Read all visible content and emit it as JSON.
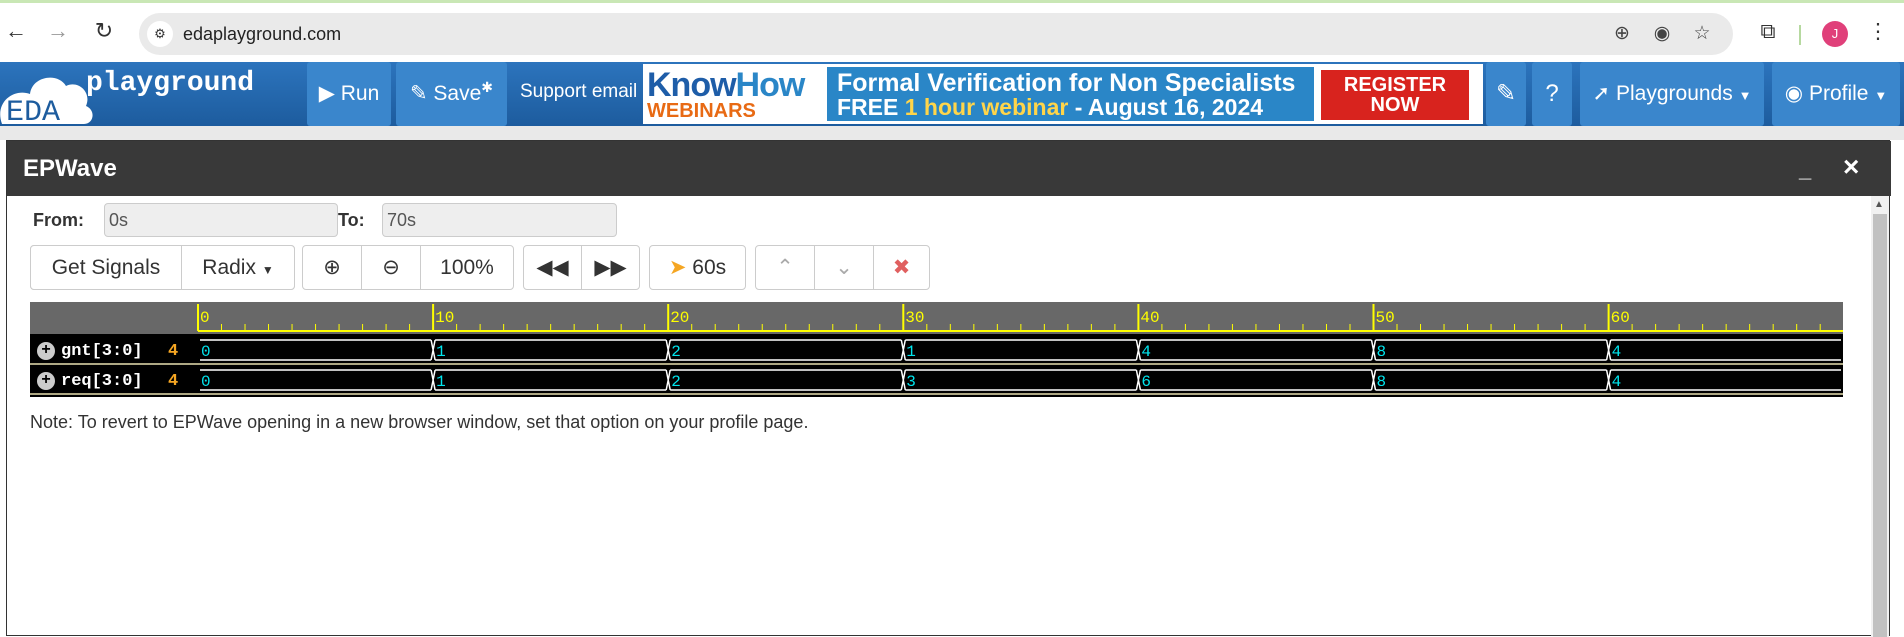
{
  "browser": {
    "url": "edaplayground.com",
    "avatar_initial": "J"
  },
  "header": {
    "logo_eda": "EDA",
    "logo_playground": "playground",
    "run_label": "Run",
    "save_label": "Save",
    "save_mark": "✱",
    "support_label": "Support email",
    "banner": {
      "knowhow_a": "Know",
      "knowhow_b": "How",
      "webinars": "WEBINARS",
      "line1": "Formal Verification for Non Specialists",
      "line2_a": "FREE ",
      "line2_b": "1 hour webinar",
      "line2_c": "  -  August 16, 2024",
      "register_1": "REGISTER",
      "register_2": "NOW"
    },
    "playgrounds_label": "Playgrounds",
    "profile_label": "Profile"
  },
  "modal": {
    "title": "EPWave",
    "from_label": "From:",
    "from_value": "0s",
    "to_label": "To:",
    "to_value": "70s",
    "toolbar": {
      "get_signals": "Get Signals",
      "radix": "Radix",
      "zoom_level": "100%",
      "cursor_time": "60s"
    },
    "note": "Note: To revert to EPWave opening in a new browser window, set that option on your profile page."
  },
  "waveform": {
    "time_start": 0,
    "time_end": 70,
    "ruler_labels": [
      "0",
      "10",
      "20",
      "30",
      "40",
      "50",
      "60"
    ],
    "signals": [
      {
        "name": "gnt[3:0]",
        "current": "4",
        "segments": [
          {
            "t": 0,
            "v": "0"
          },
          {
            "t": 10,
            "v": "1"
          },
          {
            "t": 20,
            "v": "2"
          },
          {
            "t": 30,
            "v": "1"
          },
          {
            "t": 40,
            "v": "4"
          },
          {
            "t": 50,
            "v": "8"
          },
          {
            "t": 60,
            "v": "4"
          }
        ]
      },
      {
        "name": "req[3:0]",
        "current": "4",
        "segments": [
          {
            "t": 0,
            "v": "0"
          },
          {
            "t": 10,
            "v": "1"
          },
          {
            "t": 20,
            "v": "2"
          },
          {
            "t": 30,
            "v": "3"
          },
          {
            "t": 40,
            "v": "6"
          },
          {
            "t": 50,
            "v": "8"
          },
          {
            "t": 60,
            "v": "4"
          }
        ]
      }
    ],
    "colors": {
      "ruler_text": "#ffff00",
      "value_text": "#00e5ee",
      "bus_line": "#ffffff",
      "current_value": "#f5a623"
    }
  }
}
